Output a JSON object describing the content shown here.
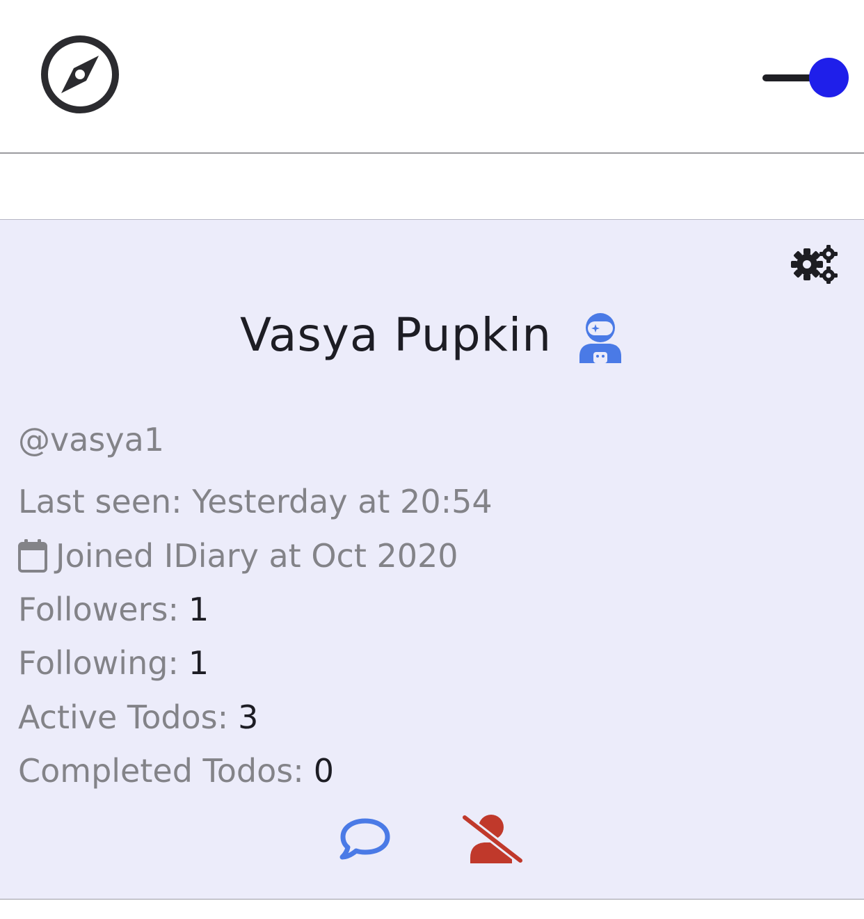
{
  "header": {
    "nav_icon": "compass-icon",
    "theme_toggle": {
      "state": "on",
      "knob_color": "#1f1fea"
    }
  },
  "profile": {
    "settings_icon": "gears-icon",
    "name": "Vasya Pupkin",
    "name_icon": "astronaut-icon",
    "handle": "@vasya1",
    "last_seen": "Last seen: Yesterday at 20:54",
    "joined": "Joined IDiary at Oct 2020",
    "joined_icon": "calendar-icon",
    "stats": {
      "followers_label": "Followers:",
      "followers_value": "1",
      "following_label": "Following:",
      "following_value": "1",
      "active_label": "Active Todos:",
      "active_value": "3",
      "completed_label": "Completed Todos:",
      "completed_value": "0"
    },
    "actions": {
      "message_icon": "chat-bubble-icon",
      "unfollow_icon": "user-slash-icon"
    }
  },
  "colors": {
    "card_bg": "#ececfa",
    "accent_blue": "#4a7ae6",
    "danger_red": "#c0392b",
    "toggle_blue": "#1f1fea"
  }
}
